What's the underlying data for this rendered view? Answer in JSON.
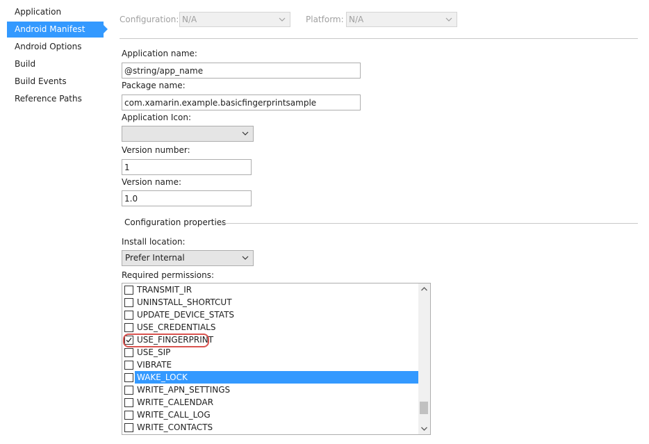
{
  "sidebar": {
    "items": [
      {
        "label": "Application"
      },
      {
        "label": "Android Manifest",
        "active": true
      },
      {
        "label": "Android Options"
      },
      {
        "label": "Build"
      },
      {
        "label": "Build Events"
      },
      {
        "label": "Reference Paths"
      }
    ]
  },
  "config_bar": {
    "configuration_label": "Configuration:",
    "configuration_value": "N/A",
    "platform_label": "Platform:",
    "platform_value": "N/A"
  },
  "form": {
    "app_name_label": "Application name:",
    "app_name_value": "@string/app_name",
    "package_name_label": "Package name:",
    "package_name_value": "com.xamarin.example.basicfingerprintsample",
    "app_icon_label": "Application Icon:",
    "app_icon_value": "",
    "version_number_label": "Version number:",
    "version_number_value": "1",
    "version_name_label": "Version name:",
    "version_name_value": "1.0"
  },
  "config_properties": {
    "title": "Configuration properties",
    "install_location_label": "Install location:",
    "install_location_value": "Prefer Internal",
    "permissions_label": "Required permissions:",
    "permissions": [
      {
        "name": "TRANSMIT_IR",
        "checked": false
      },
      {
        "name": "UNINSTALL_SHORTCUT",
        "checked": false
      },
      {
        "name": "UPDATE_DEVICE_STATS",
        "checked": false
      },
      {
        "name": "USE_CREDENTIALS",
        "checked": false
      },
      {
        "name": "USE_FINGERPRINT",
        "checked": true,
        "highlighted": true
      },
      {
        "name": "USE_SIP",
        "checked": false
      },
      {
        "name": "VIBRATE",
        "checked": false
      },
      {
        "name": "WAKE_LOCK",
        "checked": false,
        "selected": true
      },
      {
        "name": "WRITE_APN_SETTINGS",
        "checked": false
      },
      {
        "name": "WRITE_CALENDAR",
        "checked": false
      },
      {
        "name": "WRITE_CALL_LOG",
        "checked": false
      },
      {
        "name": "WRITE_CONTACTS",
        "checked": false
      }
    ]
  },
  "colors": {
    "accent": "#3399ff",
    "highlight_ring": "#d9534f"
  }
}
